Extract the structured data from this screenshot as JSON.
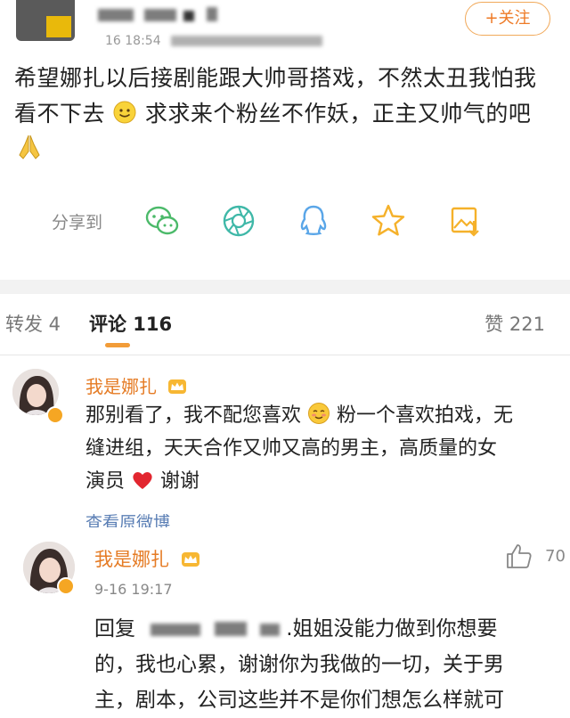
{
  "post": {
    "follow_label": "+关注",
    "time_fragment": "16 18:54",
    "text_line1": "希望娜扎以后接剧能跟大帅哥搭戏，不然太丑我怕我",
    "text_line2a": "看不下去",
    "text_line2b": "求求来个粉丝不作妖，正主又帅气的吧",
    "share_label": "分享到"
  },
  "tabs": {
    "repost_label": "转发 4",
    "comment_label": "评论 116",
    "like_label": "赞 221"
  },
  "comment1": {
    "name": "我是娜扎",
    "line1a": "那别看了，我不配您喜欢",
    "line1b": "粉一个喜欢拍戏，无",
    "line2": "缝进组，天天合作又帅又高的男主，高质量的女",
    "line3a": "演员",
    "line3b": "谢谢",
    "see_original": "查看原微博"
  },
  "comment2": {
    "name": "我是娜扎",
    "date": "9-16 19:17",
    "likes": "70",
    "reply_prefix": "回复",
    "line1": ".姐姐没能力做到你想要",
    "line2": "的，我也心累，谢谢你为我做的一切，关于男",
    "line3": "主，剧本，公司这些并不是你们想怎么样就可"
  },
  "colors": {
    "accent_orange": "#e57b24",
    "tab_underline": "#f29c38",
    "share_green": "#4cba6a",
    "share_teal": "#3fb8a8",
    "share_blue": "#5aa6e8",
    "share_yellow": "#f5b12a"
  }
}
